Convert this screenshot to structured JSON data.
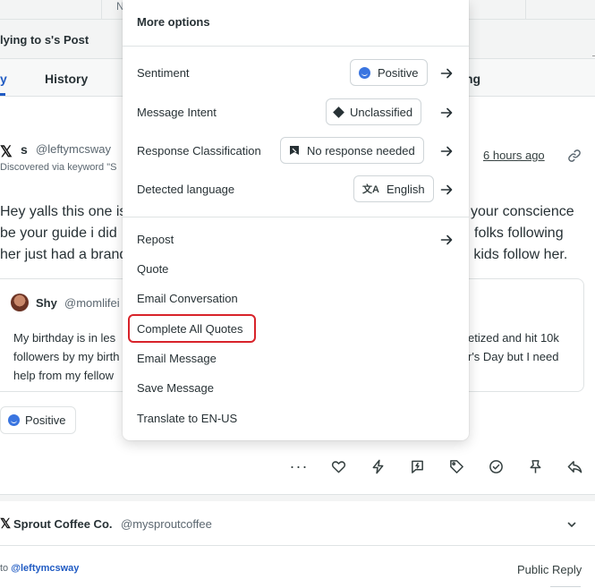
{
  "background": {
    "top_strip_letter": "N",
    "reply_title": "lying to s's Post",
    "tabs": [
      {
        "label": "y"
      },
      {
        "label": "History"
      },
      {
        "label": "ng"
      }
    ]
  },
  "message": {
    "author_name": "s",
    "author_handle": "@leftymcsway",
    "discovered": "Discovered via keyword \"S",
    "time": "6 hours ago",
    "body_lines": [
      {
        "left": "Hey yalls this one is",
        "right": "your conscience"
      },
      {
        "left": "be your guide i did",
        "right": "folks following"
      },
      {
        "left": "her just had a brand",
        "right": "d kids follow her."
      }
    ],
    "quote": {
      "name": "Shy",
      "handle": "@momlifei",
      "lines": [
        {
          "left": "My birthday is in les",
          "right": "etized and hit 10k"
        },
        {
          "left": "followers by my birth",
          "right": "r's Day but I need"
        },
        {
          "left": "help from my fellow",
          "right": ""
        }
      ]
    },
    "sentiment": "Positive"
  },
  "actions": [
    "more-icon",
    "heart-icon",
    "bolt-icon",
    "quick-reply-icon",
    "tag-icon",
    "complete-icon",
    "pin-icon",
    "reply-icon"
  ],
  "account": {
    "name": "Sprout Coffee Co.",
    "handle": "@mysproutcoffee"
  },
  "reply": {
    "to_prefix": "to",
    "to_handle": "@leftymcsway",
    "mode": "Public Reply"
  },
  "menu": {
    "title": "More options",
    "properties": [
      {
        "label": "Sentiment",
        "value": "Positive",
        "icon": "smile-icon"
      },
      {
        "label": "Message Intent",
        "value": "Unclassified",
        "icon": "diamond-icon"
      },
      {
        "label": "Response Classification",
        "value": "No response needed",
        "icon": "flag-icon"
      },
      {
        "label": "Detected language",
        "value": "English",
        "icon": "translate-icon"
      }
    ],
    "items": [
      {
        "label": "Repost",
        "has_arrow": true
      },
      {
        "label": "Quote"
      },
      {
        "label": "Email Conversation"
      },
      {
        "label": "Complete All Quotes",
        "highlighted": true
      },
      {
        "label": "Email Message"
      },
      {
        "label": "Save Message"
      },
      {
        "label": "Translate to EN-US"
      }
    ]
  },
  "colors": {
    "accent": "#205bc3",
    "highlight": "#d8232a",
    "text": "#273135"
  }
}
